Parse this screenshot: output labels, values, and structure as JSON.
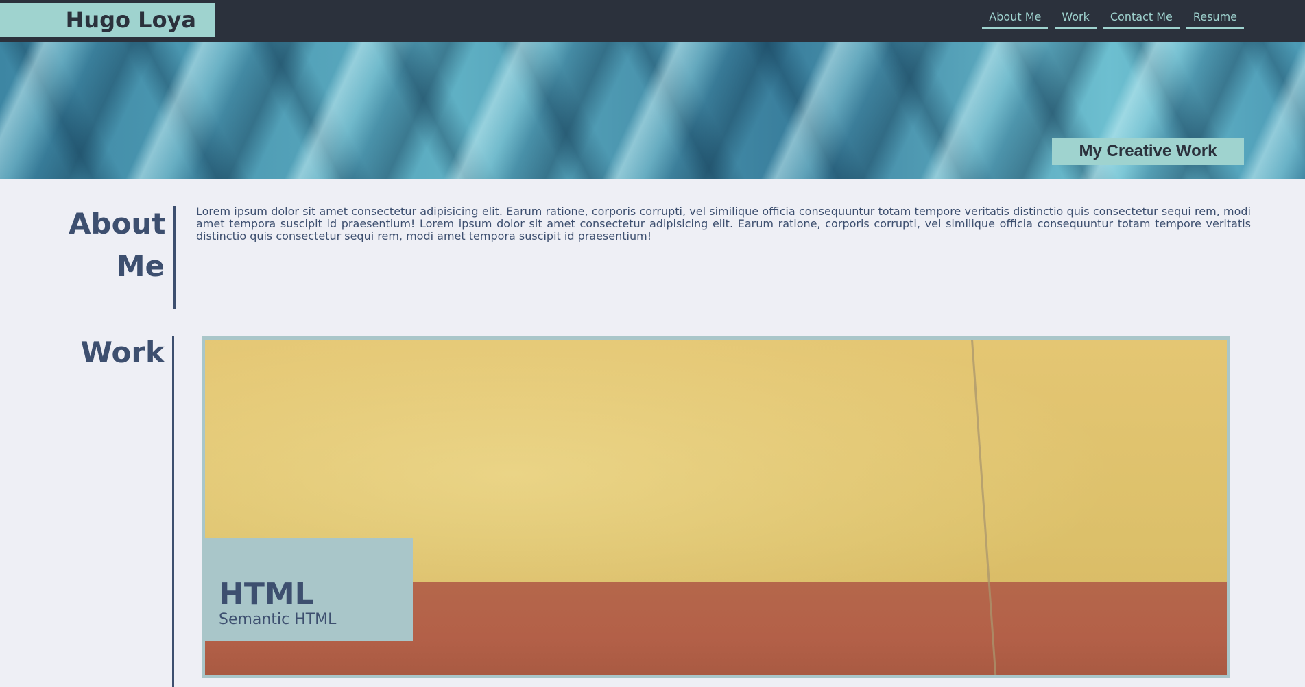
{
  "header": {
    "brand": "Hugo Loya",
    "nav": [
      {
        "label": "About Me"
      },
      {
        "label": "Work"
      },
      {
        "label": "Contact Me"
      },
      {
        "label": "Resume"
      }
    ]
  },
  "hero": {
    "tagline": "My Creative Work"
  },
  "about": {
    "title": "About Me",
    "text": "Lorem ipsum dolor sit amet consectetur adipisicing elit. Earum ratione, corporis corrupti, vel similique officia consequuntur totam tempore veritatis distinctio quis consectetur sequi rem, modi amet tempora suscipit id praesentium! Lorem ipsum dolor sit amet consectetur adipisicing elit. Earum ratione, corporis corrupti, vel similique officia consequuntur totam tempore veritatis distinctio quis consectetur sequi rem, modi amet tempora suscipit id praesentium!"
  },
  "work": {
    "title": "Work",
    "cards": [
      {
        "title": "HTML",
        "subtitle": "Semantic HTML"
      }
    ]
  },
  "colors": {
    "header_bg": "#2b313c",
    "accent": "#9fd3cf",
    "text_primary": "#3d4f6f",
    "page_bg": "#eeeff5",
    "card_label_bg": "#a9c6c9"
  }
}
